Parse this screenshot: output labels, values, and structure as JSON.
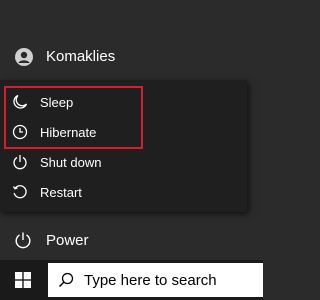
{
  "user": {
    "name": "Komaklies",
    "icon": "user-icon"
  },
  "power_menu": {
    "items": [
      {
        "label": "Sleep",
        "icon": "moon-icon"
      },
      {
        "label": "Hibernate",
        "icon": "clock-icon"
      },
      {
        "label": "Shut down",
        "icon": "power-icon"
      },
      {
        "label": "Restart",
        "icon": "restart-icon"
      }
    ]
  },
  "power_button": {
    "label": "Power",
    "icon": "power-icon"
  },
  "taskbar": {
    "start_icon": "windows-logo-icon",
    "search_placeholder": "Type here to search",
    "search_icon": "search-icon"
  },
  "colors": {
    "menu_bg": "#2b2b2b",
    "flyout_bg": "#1f1f1f",
    "highlight": "#d81e2c",
    "taskbar_bg": "#1a1a1a"
  }
}
